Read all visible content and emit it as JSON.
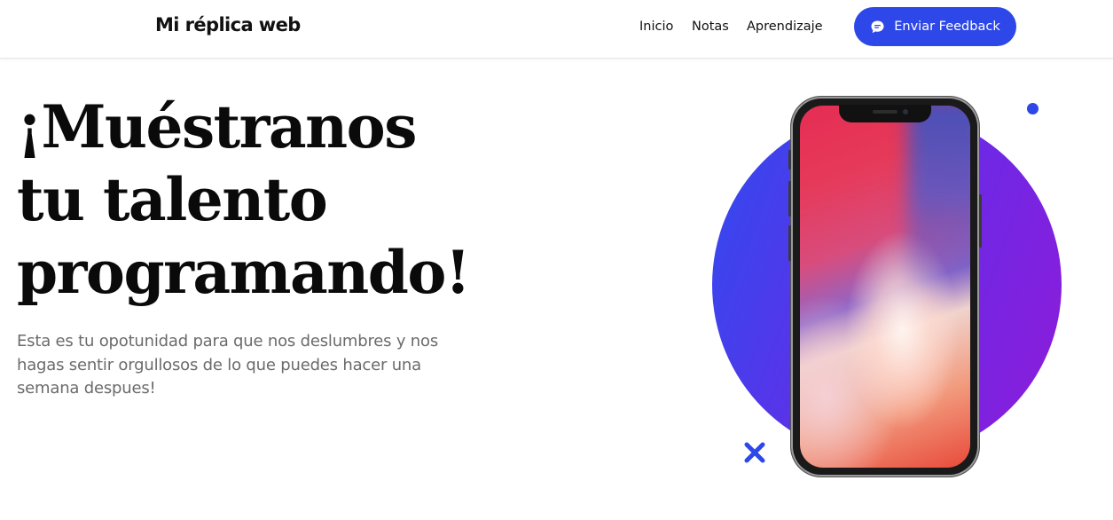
{
  "header": {
    "brand": "Mi réplica web",
    "nav": [
      {
        "label": "Inicio"
      },
      {
        "label": "Notas"
      },
      {
        "label": "Aprendizaje"
      }
    ],
    "cta": {
      "label": "Enviar Feedback",
      "icon": "chat-bubble-icon"
    }
  },
  "hero": {
    "title_lines": [
      "¡Muéstranos",
      "tu talento",
      "programando!"
    ],
    "subtitle": "Esta es tu opotunidad para que nos deslumbres y nos hagas sentir orgullosos de lo que puedes hacer una semana despues!"
  },
  "art": {
    "circle_gradient": [
      "#2f4bef",
      "#8e1bd9"
    ],
    "accent": "#2d47e8",
    "icons": [
      "dot-icon",
      "cross-icon",
      "smartphone-illustration"
    ]
  },
  "colors": {
    "accent": "#2d47e8",
    "text": "#0a0a0a",
    "muted": "#6b6b6b"
  }
}
